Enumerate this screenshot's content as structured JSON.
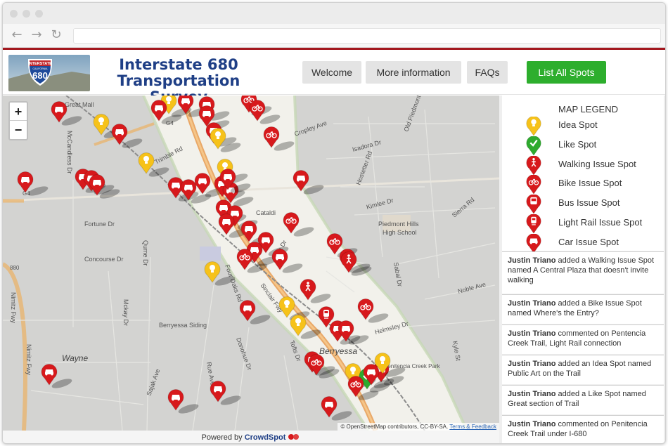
{
  "header": {
    "logo_shield_top": "INTERSTATE",
    "logo_shield_state": "CALIFORNIA",
    "logo_shield_number": "680",
    "title_line1": "Interstate 680",
    "title_line2": "Transportation Survey",
    "nav": [
      {
        "label": "Welcome"
      },
      {
        "label": "More information"
      },
      {
        "label": "FAQs"
      },
      {
        "label": "List All Spots"
      }
    ]
  },
  "map": {
    "zoom_in": "+",
    "zoom_out": "−",
    "attribution": "© OpenStreetMap contributors, CC-BY-SA.",
    "attribution_link": "Terms & Feedback",
    "labels": {
      "great_mall": "Great Mall",
      "g4_left": "G4",
      "g4_top": "G4",
      "trimble": "Trimble Rd",
      "mccandless": "McCandless Dr",
      "fortune": "Fortune Dr",
      "qume": "Qume Dr",
      "concourse": "Concourse Dr",
      "nimitz": "Nimitz Fwy",
      "mckay": "Mckay Dr",
      "wayne": "Wayne",
      "sajak": "Sajak Ave",
      "rue": "Rue Ave",
      "berryessa_siding": "Berryessa Siding",
      "donohue": "Donohue Dr",
      "tofts": "Tofts Dr",
      "sinclair": "Sinclair Fwy",
      "four_oaks": "Four Oaks Rd",
      "cataldi": "Cataldi",
      "berryessa": "Berryessa",
      "piedmont_hills": "Piedmont Hills",
      "high_school": "High School",
      "cropley": "Cropley Ave",
      "old_piedmont": "Old Piedmont Rd",
      "isadora": "Isadora Dr",
      "hostetter": "Hostetter Rd",
      "kimlee": "Kimlee Dr",
      "sierra": "Sierra Rd",
      "sabal": "Sabal Dr",
      "noble": "Noble Ave",
      "helmsley": "Helmsley Dr",
      "kyle": "Kyle St",
      "penitencia": "Penitencia Creek Park",
      "lena": "Lena Dr",
      "n880": "880"
    }
  },
  "powered_by": {
    "prefix": "Powered by",
    "brand": "CrowdSpot"
  },
  "legend": {
    "title": "MAP LEGEND",
    "items": [
      {
        "label": "Idea Spot",
        "icon": "lightbulb-icon",
        "color": "#f6c21a"
      },
      {
        "label": "Like Spot",
        "icon": "checkmark-icon",
        "color": "#2eaa2e"
      },
      {
        "label": "Walking Issue Spot",
        "icon": "walking-icon",
        "color": "#d7191c"
      },
      {
        "label": "Bike Issue Spot",
        "icon": "bike-icon",
        "color": "#d7191c"
      },
      {
        "label": "Bus Issue Spot",
        "icon": "bus-icon",
        "color": "#d7191c"
      },
      {
        "label": "Light Rail Issue Spot",
        "icon": "light-rail-icon",
        "color": "#d7191c"
      },
      {
        "label": "Car Issue Spot",
        "icon": "car-icon",
        "color": "#d7191c"
      }
    ]
  },
  "feed": [
    {
      "user": "Justin Triano",
      "text": "added a Walking Issue Spot named A Central Plaza that doesn't invite walking"
    },
    {
      "user": "Justin Triano",
      "text": "added a Bike Issue Spot named Where's the Entry?"
    },
    {
      "user": "Justin Triano",
      "text": "commented on Pentencia Creek Trail, Light Rail connection"
    },
    {
      "user": "Justin Triano",
      "text": "added an Idea Spot named Public Art on the Trail"
    },
    {
      "user": "Justin Triano",
      "text": "added a Like Spot named Great section of Trail"
    },
    {
      "user": "Justin Triano",
      "text": "commented on Penitencia Creek Trail under I-680"
    }
  ]
}
